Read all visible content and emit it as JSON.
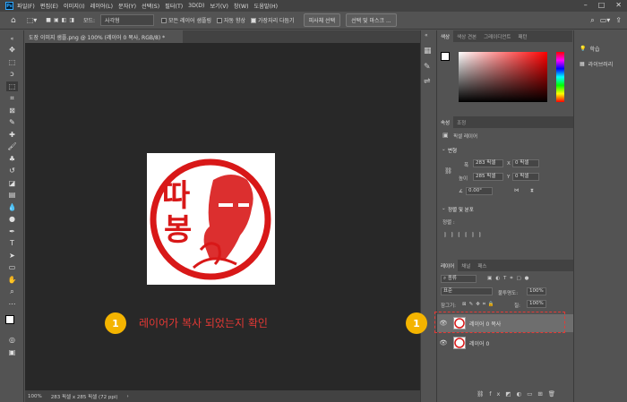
{
  "menu": [
    "파일(F)",
    "편집(E)",
    "이미지(I)",
    "레이어(L)",
    "문자(Y)",
    "선택(S)",
    "필터(T)",
    "3D(D)",
    "보기(V)",
    "창(W)",
    "도움말(H)"
  ],
  "app_logo": "Ps",
  "options": {
    "mode_label": "모드:",
    "mode_value": "사각형",
    "sample_all_layers": "모든 레이어 샘플링",
    "auto_enhance": "자동 향상",
    "hard_edge": "가장자리 다듬기",
    "select_subject": "피사체 선택",
    "select_mask": "선택 및 마스크 ..."
  },
  "document_tab": "도장 이미지 샘플.png @ 100% (레이어 0 복사, RGB/8) *",
  "stamp": {
    "char1": "따",
    "char2": "봉"
  },
  "annotations": {
    "num1": "1",
    "text1": "레이어가 복사 되었는지 확인",
    "num2": "1"
  },
  "status": {
    "zoom": "100%",
    "size": "283 픽셀 x 285 픽셀 (72 ppi)"
  },
  "color_panel": {
    "tabs": [
      "색상",
      "색상 견본",
      "그레이디언트",
      "패턴"
    ]
  },
  "properties": {
    "tabs": [
      "속성",
      "조정"
    ],
    "pixel_layer": "픽셀 레이어",
    "transform_title": "변형",
    "w_label": "폭",
    "w_value": "283 픽셀",
    "x_label": "X",
    "x_value": "0 픽셀",
    "h_label": "높이",
    "h_value": "285 픽셀",
    "y_label": "Y",
    "y_value": "0 픽셀",
    "angle_value": "0.00°",
    "align_title": "정렬 및 분포",
    "align_label": "정렬 :"
  },
  "layers": {
    "tabs": [
      "레이어",
      "채널",
      "패스"
    ],
    "kind_filter": "종류",
    "blend_mode": "표준",
    "opacity_label": "불투명도:",
    "opacity_value": "100%",
    "lock_label": "잠그기:",
    "fill_label": "칠:",
    "fill_value": "100%",
    "rows": [
      {
        "name": "레이어 0 복사",
        "selected": true
      },
      {
        "name": "레이어 0",
        "selected": false
      }
    ]
  },
  "right_panel": {
    "learn": "학습",
    "libraries": "라이브러리"
  }
}
